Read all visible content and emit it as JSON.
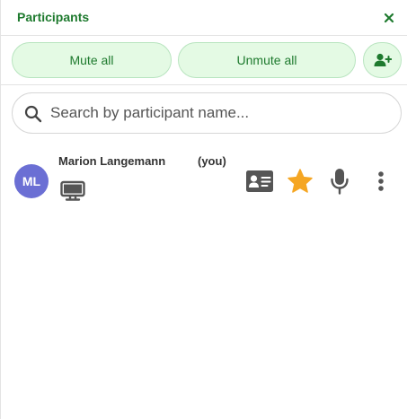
{
  "header": {
    "title": "Participants",
    "close_icon": "close-icon"
  },
  "actions": {
    "mute_all_label": "Mute all",
    "unmute_all_label": "Unmute all",
    "invite_icon": "add-person-icon"
  },
  "search": {
    "placeholder": "Search by participant name...",
    "value": ""
  },
  "participants": [
    {
      "initials": "ML",
      "name": "Marion Langemann",
      "self_tag": "(you)",
      "avatar_color": "#6b6fd4",
      "device_icon": "monitor-icon",
      "icons": [
        "contact-card-icon",
        "star-icon",
        "microphone-icon",
        "more-vertical-icon"
      ]
    }
  ],
  "colors": {
    "accent": "#1e7a2e",
    "button_bg": "#e4fae4",
    "star": "#f5a623",
    "icon_gray": "#555555"
  }
}
